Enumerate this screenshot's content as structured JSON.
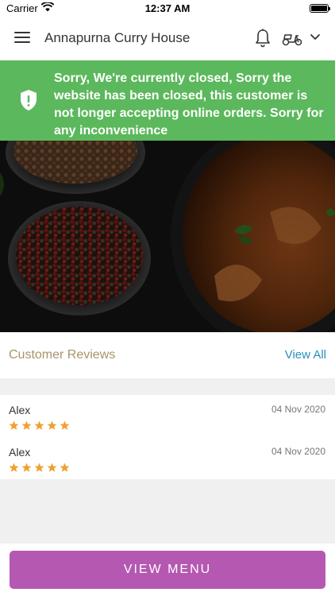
{
  "status_bar": {
    "carrier": "Carrier",
    "time": "12:37 AM",
    "wifi_icon": "wifi-icon",
    "battery_icon": "battery-icon"
  },
  "header": {
    "title": "Annapurna Curry House",
    "menu_icon": "hamburger-menu-icon",
    "notification_icon": "bell-icon",
    "delivery_icon": "scooter-icon",
    "dropdown_icon": "chevron-down-icon"
  },
  "closed_banner": {
    "message": "Sorry, We're currently closed, Sorry the website has been closed, this customer is not longer accepting online orders. Sorry for any inconvenience",
    "icon": "shield-alert-icon",
    "color": "#5cb85c"
  },
  "reviews": {
    "title": "Customer Reviews",
    "view_all_label": "View All",
    "items": [
      {
        "name": "Alex",
        "date": "04 Nov 2020",
        "rating": 5
      },
      {
        "name": "Alex",
        "date": "04 Nov 2020",
        "rating": 5
      }
    ]
  },
  "footer": {
    "view_menu_label": "VIEW MENU",
    "button_color": "#b558b1"
  },
  "colors": {
    "star": "#f0a030",
    "link": "#2a8fbd",
    "section_title": "#a8946a"
  }
}
